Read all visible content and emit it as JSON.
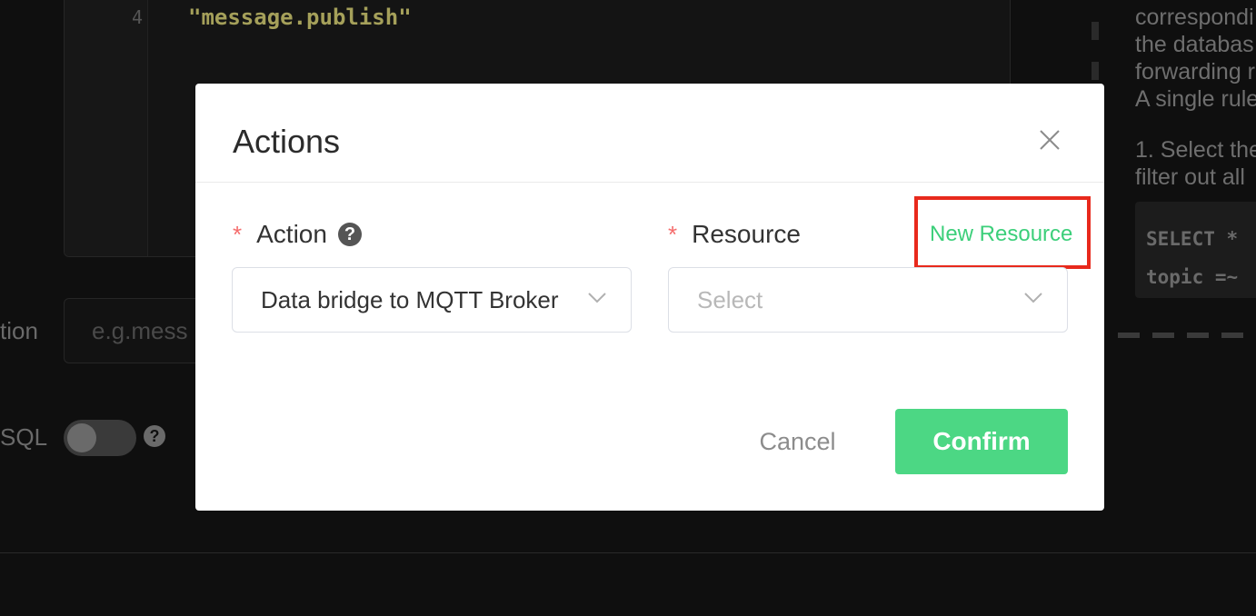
{
  "background": {
    "code_editor": {
      "line_number": "4",
      "line_text": "\"message.publish\""
    },
    "condition_label": "tion",
    "condition_placeholder": "e.g.mess",
    "sql_label": "SQL",
    "help_text_lines": [
      "correspondi",
      "the databas",
      "forwarding r",
      "A single rule",
      "",
      "1. Select the",
      "filter out all"
    ],
    "code_block_lines": [
      "SELECT *",
      "topic =~"
    ]
  },
  "modal": {
    "title": "Actions",
    "action_field": {
      "label": "Action",
      "required_mark": "*",
      "value": "Data bridge to MQTT Broker"
    },
    "resource_field": {
      "label": "Resource",
      "required_mark": "*",
      "placeholder": "Select"
    },
    "new_resource_link": "New Resource",
    "cancel_label": "Cancel",
    "confirm_label": "Confirm"
  },
  "colors": {
    "accent": "#4cd784",
    "link": "#3ccf7a",
    "required": "#f56c6c",
    "highlight": "#e8291c"
  }
}
